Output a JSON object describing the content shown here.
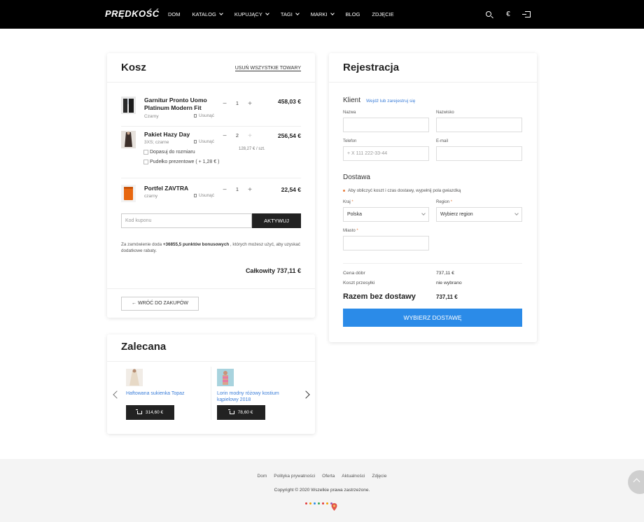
{
  "header": {
    "logo": "PRĘDKOŚĆ",
    "nav": [
      {
        "label": "DOM",
        "dropdown": false
      },
      {
        "label": "KATALOG",
        "dropdown": true
      },
      {
        "label": "KUPUJĄCY",
        "dropdown": true
      },
      {
        "label": "TAGI",
        "dropdown": true
      },
      {
        "label": "MARKI",
        "dropdown": true
      },
      {
        "label": "BLOG",
        "dropdown": false
      },
      {
        "label": "ZDJĘCIE",
        "dropdown": false
      }
    ],
    "currency": "€"
  },
  "cart": {
    "title": "Kosz",
    "clear_all": "USUŃ WSZYSTKIE TOWARY",
    "remove_label": "Usunąć",
    "items": [
      {
        "name": "Garnitur Pronto Uomo Platinum Modern Fit",
        "variant": "Czarny",
        "qty": "1",
        "price": "458,03 €"
      },
      {
        "name": "Pakiet Hazy Day",
        "variant": "3XS; czarne",
        "qty": "2",
        "price": "256,54 €",
        "unit_price": "128,27 € / szt.",
        "options": [
          "Dopasuj do rozmiaru",
          "Pudełko prezentowe ( + 1,28 € )"
        ]
      },
      {
        "name": "Portfel ZAVTRA",
        "variant": "czarny",
        "qty": "1",
        "price": "22,54 €"
      }
    ],
    "coupon_placeholder": "Kod kuponu",
    "coupon_button": "AKTYWUJ",
    "bonus_prefix": "Za zamówienie doda ",
    "bonus_points": "+36855,5 punktów bonusowych",
    "bonus_suffix": " , których możesz użyć, aby uzyskać dodatkowe rabaty.",
    "total": "Całkowity 737,11 €",
    "back_button": "← WRÓĆ DO ZAKUPÓW"
  },
  "recommended": {
    "title": "Zalecana",
    "products": [
      {
        "name": "Haftowana sukienka Topaz",
        "price": "314,60 €"
      },
      {
        "name": "Lorin modny różowy kostium kąpielowy 2018",
        "price": "78,60 €"
      }
    ]
  },
  "registration": {
    "title": "Rejestracja",
    "client_title": "Klient",
    "login_link": "Wejdź lub zarejestruj się",
    "name_label": "Nazwa",
    "surname_label": "Nazwisko",
    "phone_label": "Telefon",
    "phone_placeholder": "+ X 111 222-33-44",
    "email_label": "E-mail",
    "delivery_title": "Dostawa",
    "delivery_note": "Aby obliczyć koszt i czas dostawy, wypełnij pola gwiazdką",
    "country_label": "Kraj",
    "country_value": "Polska",
    "region_label": "Region",
    "region_value": "Wybierz region",
    "city_label": "Miasto",
    "goods_price_label": "Cena dóbr",
    "goods_price_value": "737,11 €",
    "shipping_cost_label": "Koszt przesyłki",
    "shipping_cost_value": "nie wybrano",
    "total_label": "Razem bez dostawy",
    "total_value": "737,11 €",
    "ship_button": "WYBIERZ DOSTAWĘ"
  },
  "footer": {
    "links": [
      "Dom",
      "Polityka prywatności",
      "Oferta",
      "Aktualności",
      "Zdjęcie"
    ],
    "copyright": "Copyright © 2020 Wszelkie prawa zastrzeżone.",
    "payment_colors": [
      "#e23a3a",
      "#f2a100",
      "#2b8be8",
      "#34a853",
      "#e23a3a",
      "#f2a100",
      "#9b59b6"
    ]
  },
  "colors": {
    "accent": "#2b8be8",
    "link": "#3d7fd9",
    "required": "#e87c3e",
    "dark": "#222222"
  }
}
